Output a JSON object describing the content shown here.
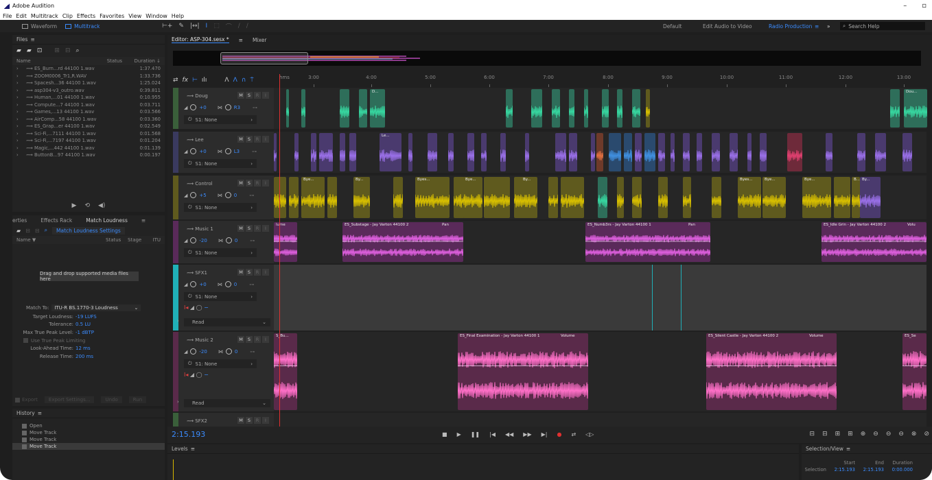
{
  "window": {
    "title": "Adobe Audition",
    "min_glyph": "–",
    "max_glyph": "▫"
  },
  "menu": [
    "File",
    "Edit",
    "Multitrack",
    "Clip",
    "Effects",
    "Favorites",
    "View",
    "Window",
    "Help"
  ],
  "toolbar": {
    "waveform_label": "Waveform",
    "multitrack_label": "Multitrack",
    "workspaces": [
      "Default",
      "Edit Audio to Video",
      "Radio Production"
    ],
    "overflow_label": "»",
    "search_placeholder": "Search Help"
  },
  "files_panel": {
    "title": "Files",
    "col_name": "Name",
    "col_status": "Status",
    "col_duration": "Duration ↓",
    "files": [
      {
        "name": "ES_Burn...rd 44100 1.wav",
        "duration": "1:37.470"
      },
      {
        "name": "ZOOM0006_Tr1,R.WAV",
        "duration": "1:33.736"
      },
      {
        "name": "Spacesh...36 44100 1.wav",
        "duration": "1:25.024"
      },
      {
        "name": "asp304-v3_outro.wav",
        "duration": "0:39.811"
      },
      {
        "name": "Human,...01 44100 1.wav",
        "duration": "0:10.955"
      },
      {
        "name": "Compute...7 44100 1.wav",
        "duration": "0:03.711"
      },
      {
        "name": "Games,...13 44100 1.wav",
        "duration": "0:03.566"
      },
      {
        "name": "AirComp...58 44100 1.wav",
        "duration": "0:03.360"
      },
      {
        "name": "ES_Grap...er 44100 1.wav",
        "duration": "0:02.549"
      },
      {
        "name": "Sci-Fi,...7111 44100 1.wav",
        "duration": "0:01.568"
      },
      {
        "name": "Sci-Fi,...7197 44100 1.wav",
        "duration": "0:01.204"
      },
      {
        "name": "Magic,...442 44100 1.wav",
        "duration": "0:01.139"
      },
      {
        "name": "ButtonB...97 44100 1.wav",
        "duration": "0:00.197"
      }
    ]
  },
  "match_panel": {
    "tab_properties": "erties",
    "tab_effects": "Effects Rack",
    "tab_match": "Match Loudness",
    "settings_label": "Match Loudness Settings",
    "col_name": "Name ▼",
    "col_status": "Status",
    "col_stage": "Stage",
    "col_itu": "ITU",
    "drop_message": "Drag and drop supported media files here",
    "match_to_label": "Match To:",
    "match_to_value": "ITU-R BS.1770-3 Loudness",
    "fields": [
      {
        "label": "Target Loudness:",
        "value": "-19 LUFS"
      },
      {
        "label": "Tolerance:",
        "value": "0.5 LU"
      },
      {
        "label": "Max True Peak Level:",
        "value": "-1 dBTP"
      }
    ],
    "use_true_peak_label": "Use True Peak Limiting",
    "fields2": [
      {
        "label": "Look-Ahead Time:",
        "value": "12 ms"
      },
      {
        "label": "Release Time:",
        "value": "200 ms"
      }
    ],
    "export_label": "Export",
    "export_settings_label": "Export Settings...",
    "undo_label": "Undo",
    "run_label": "Run"
  },
  "history": {
    "title": "History",
    "items": [
      "Open",
      "Move Track",
      "Move Track",
      "Move Track"
    ]
  },
  "editor": {
    "tab_editor": "Editor: ASP-304.sesx *",
    "tab_mixer": "Mixer",
    "ruler_unit": "hms",
    "ruler_ticks": [
      "3:00",
      "4:00",
      "5:00",
      "6:00",
      "7:00",
      "8:00",
      "9:00",
      "10:00",
      "11:00",
      "12:00",
      "13:00"
    ],
    "tracks": [
      {
        "name": "Doug",
        "color": "#3a5f3a",
        "vol": "+0",
        "pan": "R3",
        "send": "S1: None"
      },
      {
        "name": "Lee",
        "color": "#3a3a5f",
        "vol": "+0",
        "pan": "L3",
        "send": "S1: None"
      },
      {
        "name": "Control",
        "color": "#5f5a1e",
        "vol": "+5",
        "pan": "0",
        "send": "S1: None"
      },
      {
        "name": "Music 1",
        "color": "#5a2a5a",
        "vol": "-20",
        "pan": "0",
        "send": "S1: None"
      },
      {
        "name": "SFX1",
        "color": "#20b0b8",
        "vol": "+0",
        "pan": "0",
        "send": "S1: None",
        "read": "Read"
      },
      {
        "name": "Music 2",
        "color": "#5a2a4a",
        "vol": "-20",
        "pan": "0",
        "send": "S1: None",
        "read": "Read"
      },
      {
        "name": "SFX2",
        "color": "#3a5f3a"
      }
    ],
    "clip_labels": {
      "doug_a": "D...",
      "doug_b": "Dou...",
      "lee_a": "Le...",
      "ctrl_a": "Bye...",
      "ctrl_b": "By...",
      "ctrl_c": "Byes...",
      "ctrl_d": "Bye...",
      "ctrl_e": "By...",
      "ctrl_f": "Byes...",
      "ctrl_g": "Bye...",
      "ctrl_h": "Bye...",
      "ctrl_i": "B...",
      "ctrl_j": "By...",
      "m1_a": "lume",
      "m1_b": "ES_Substage - Jay Varton 44100 2",
      "m1_b_param": "Pan",
      "m1_c": "ES_Numb3rs - Jay Varton 44100 1",
      "m1_c_param": "Pan",
      "m1_d": "ES_Idle Grin - Jay Varton 44100 2",
      "m1_d_param": "Volu",
      "m2_a": "S_Bu...",
      "m2_b": "ES_Final Examination - Jay Varton 44100 1",
      "m2_b_param": "Volume",
      "m2_c": "ES_Silent Castle - Jay Varton 44100 2",
      "m2_c_param": "Volume",
      "m2_d": "ES_Se"
    }
  },
  "transport": {
    "timecode": "2:15.193",
    "controls": [
      "■",
      "▶",
      "❚❚",
      "|◀",
      "◀◀",
      "▶▶",
      "▶|",
      "●",
      "⇄",
      "◁▷"
    ],
    "zoom_controls": [
      "⊟",
      "⊟",
      "⊞",
      "⊞",
      "⊕",
      "⊖",
      "⊖",
      "⊖",
      "⊗",
      "⊘"
    ]
  },
  "levels": {
    "title": "Levels"
  },
  "selection_view": {
    "title": "Selection/View",
    "col_start": "Start",
    "col_end": "End",
    "col_duration": "Duration",
    "row_label": "Selection",
    "start": "2:15.193",
    "end": "2:15.193",
    "duration": "0:00.000"
  }
}
